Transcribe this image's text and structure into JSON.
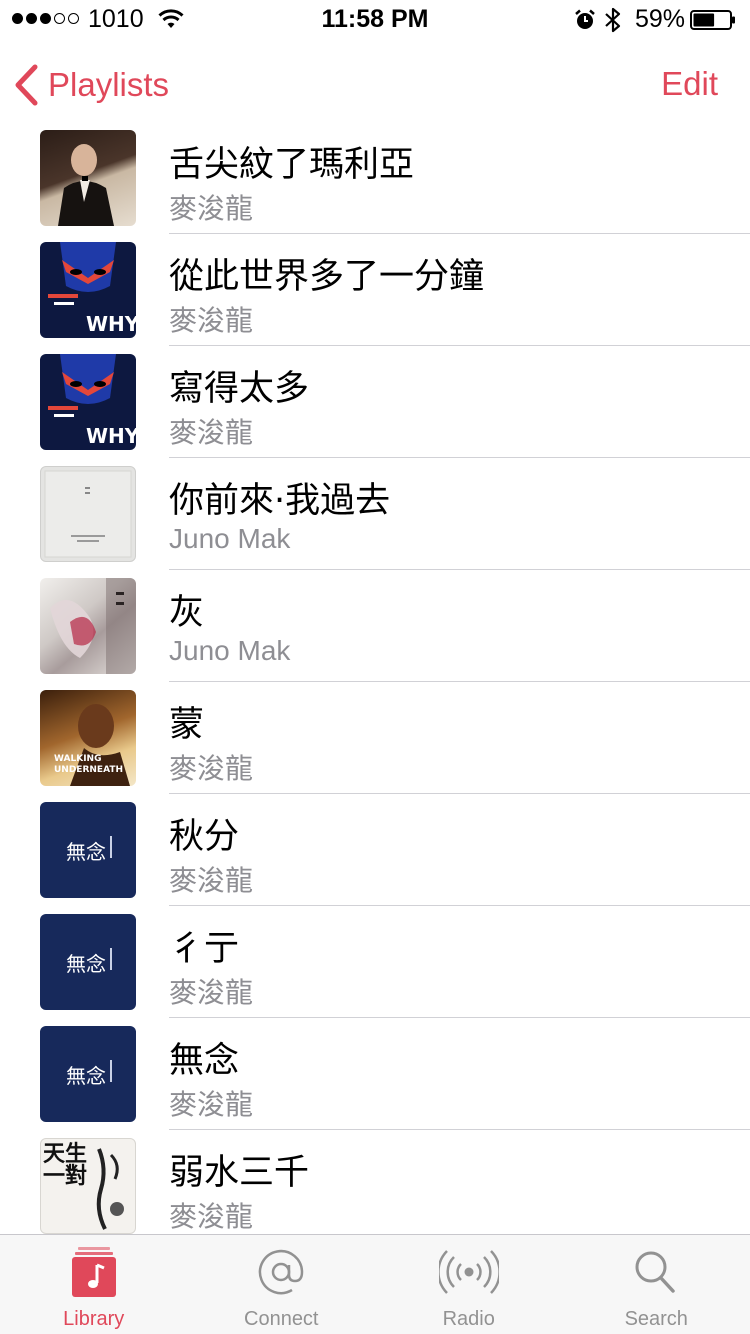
{
  "status_bar": {
    "carrier": "1010",
    "time": "11:58 PM",
    "battery_percent": "59%",
    "battery_level": 0.59,
    "signal_bars_filled": 3,
    "signal_bars_total": 5
  },
  "nav": {
    "back_label": "Playlists",
    "edit_label": "Edit"
  },
  "songs": [
    {
      "title": "舌尖紋了瑪利亞",
      "artist": "麥浚龍"
    },
    {
      "title": "從此世界多了一分鐘",
      "artist": "麥浚龍"
    },
    {
      "title": "寫得太多",
      "artist": "麥浚龍"
    },
    {
      "title": "你前來·我過去",
      "artist": "Juno Mak"
    },
    {
      "title": "灰",
      "artist": "Juno Mak"
    },
    {
      "title": "蒙",
      "artist": "麥浚龍"
    },
    {
      "title": "秋分",
      "artist": "麥浚龍"
    },
    {
      "title": "彳亍",
      "artist": "麥浚龍"
    },
    {
      "title": "無念",
      "artist": "麥浚龍"
    },
    {
      "title": "弱水三千",
      "artist": "麥浚龍"
    }
  ],
  "artwork_text": {
    "why_album": "WHY",
    "walking_album_1": "WALKING",
    "walking_album_2": "UNDERNEATH",
    "wunian_album": "無念",
    "calli_album": "天生一對"
  },
  "tabs": [
    {
      "label": "Library",
      "icon": "music-note-icon",
      "active": true
    },
    {
      "label": "Connect",
      "icon": "at-sign-icon",
      "active": false
    },
    {
      "label": "Radio",
      "icon": "broadcast-icon",
      "active": false
    },
    {
      "label": "Search",
      "icon": "search-icon",
      "active": false
    }
  ],
  "colors": {
    "accent": "#e0485a",
    "secondary_text": "#8e8e93",
    "separator": "#d1d1d6",
    "tab_inactive": "#929292"
  }
}
